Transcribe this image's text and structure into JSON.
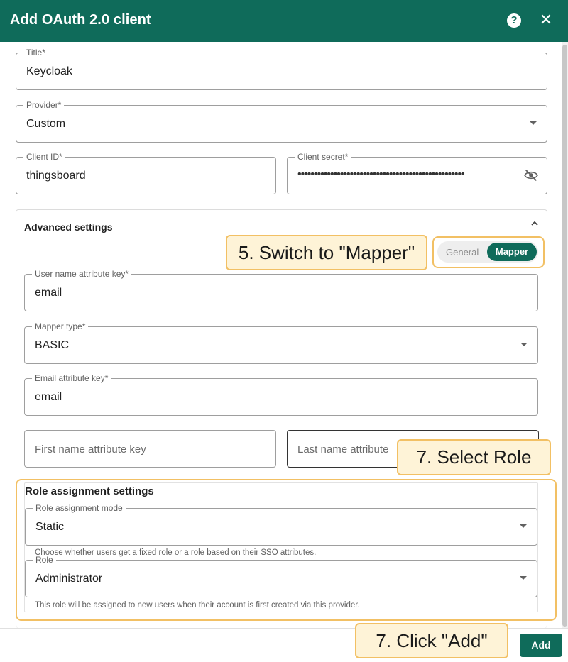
{
  "dialog": {
    "title": "Add OAuth 2.0 client",
    "help_icon": "help-icon",
    "close_icon": "close-icon"
  },
  "fields": {
    "title": {
      "label": "Title*",
      "value": "Keycloak"
    },
    "provider": {
      "label": "Provider*",
      "value": "Custom"
    },
    "client_id": {
      "label": "Client ID*",
      "value": "thingsboard"
    },
    "client_secret": {
      "label": "Client secret*",
      "value": "•••••••••••••••••••••••••••••••••••••••••••••••••••"
    }
  },
  "advanced": {
    "title": "Advanced settings",
    "toggle": {
      "general": "General",
      "mapper": "Mapper",
      "selected": "Mapper"
    },
    "user_name_key": {
      "label": "User name attribute key*",
      "value": "email"
    },
    "mapper_type": {
      "label": "Mapper type*",
      "value": "BASIC"
    },
    "email_key": {
      "label": "Email attribute key*",
      "value": "email"
    },
    "first_name_key": {
      "placeholder": "First name attribute key"
    },
    "last_name_key": {
      "placeholder": "Last name attribute"
    }
  },
  "role_settings": {
    "title": "Role assignment settings",
    "mode": {
      "label": "Role assignment mode",
      "value": "Static",
      "hint": "Choose whether users get a fixed role or a role based on their SSO attributes."
    },
    "role": {
      "label": "Role",
      "value": "Administrator",
      "hint": "This role will be assigned to new users when their account is first created via this provider."
    }
  },
  "callouts": {
    "switch_mapper": "5. Switch to \"Mapper\"",
    "select_role": "7. Select Role",
    "click_add": "7. Click \"Add\""
  },
  "footer": {
    "add_label": "Add"
  },
  "colors": {
    "brand": "#0f6b5a",
    "callout_bg": "#fef3d7",
    "callout_border": "#f2c064"
  }
}
